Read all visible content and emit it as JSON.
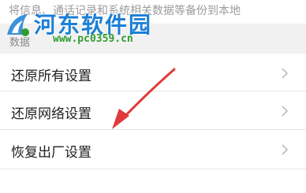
{
  "description_text": "将信息、通话记录和系统相关数据等备份到本地",
  "section_header": "数据",
  "rows": [
    {
      "label": "还原所有设置"
    },
    {
      "label": "还原网络设置"
    },
    {
      "label": "恢复出厂设置"
    }
  ],
  "watermark": {
    "name": "河东软件园",
    "url": "www.pc0359.cn"
  },
  "colors": {
    "arrow": "#e03a3a",
    "watermark_blue": "#1b7fd6",
    "watermark_green": "#2f9d2f"
  },
  "icons": {
    "row_chevron": "chevron-right-icon",
    "watermark_logo": "logo-icon",
    "annotation": "arrow-annotation"
  }
}
